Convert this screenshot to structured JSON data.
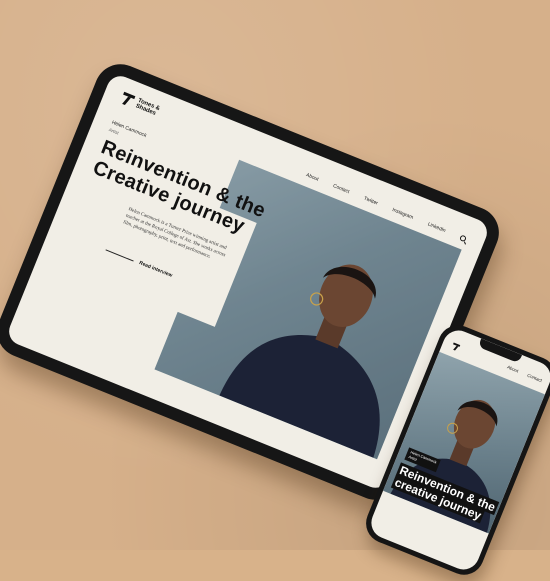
{
  "brand": {
    "name": "Tones & Shades"
  },
  "author": {
    "name": "Helen Cammock",
    "role": "Artist"
  },
  "nav": {
    "items": [
      "About",
      "Contact",
      "Twitter",
      "Instagram",
      "LinkedIn"
    ]
  },
  "hero": {
    "headline": "Reinvention & the Creative journey",
    "blurb": "Helen Cammock is a Turner Prize winning artist and teacher at the Royal College of Art. She works across film, photography, print, text and performance.",
    "cta": "Read interview"
  },
  "phone": {
    "nav": [
      "About",
      "Contact"
    ],
    "author_name": "Helen Cammock",
    "author_role": "Artist",
    "headline": "Reinvention & the creative journey"
  },
  "icons": {
    "search": "search-icon",
    "logo": "logo-mark-icon"
  },
  "colors": {
    "background": "#d6b08a",
    "screen": "#f1eee6",
    "ink": "#111111",
    "photo": "#6f8590"
  }
}
